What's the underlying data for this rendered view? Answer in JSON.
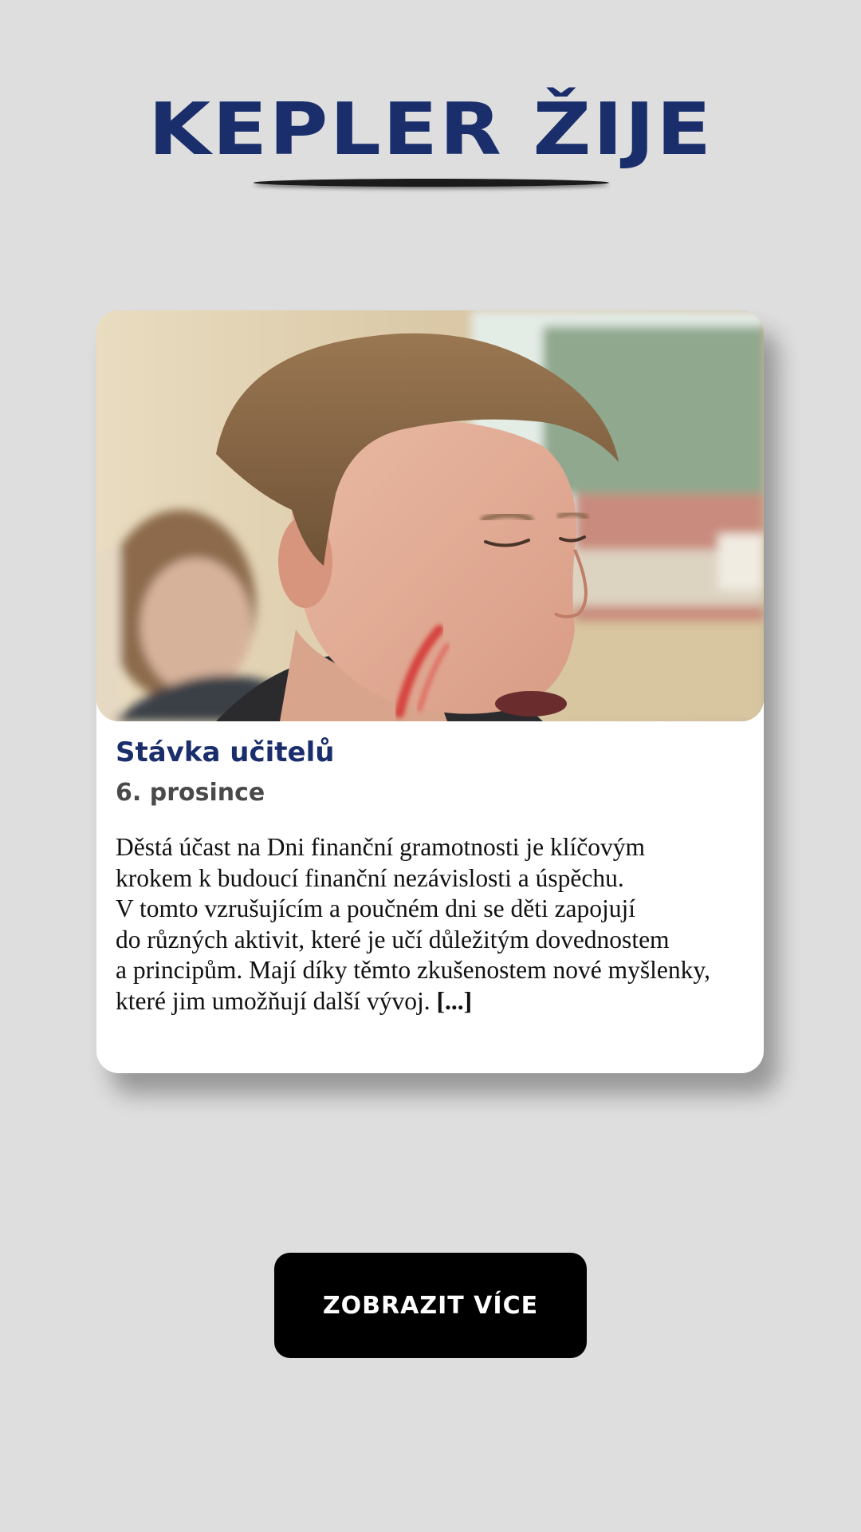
{
  "logo": {
    "text": "KEPLER ŽIJE"
  },
  "article": {
    "image_icon": "portrait-photo",
    "title": "Stávka učitelů",
    "date": "6. prosince",
    "body_lines": [
      "Děstá účast na Dni finanční gramotnosti je klíčovým",
      "krokem k budoucí finanční nezávislosti a úspěchu.",
      "V tomto vzrušujícím a poučném dni se děti zapojují",
      "do různých aktivit, které je učí důležitým dovednostem",
      "a principům. Mají díky těmto zkušenostem nové myšlenky,",
      "které jim umožňují další vývoj."
    ],
    "read_more": "[...]"
  },
  "buttons": {
    "show_more": "ZOBRAZIT VÍCE"
  },
  "colors": {
    "background": "#dedede",
    "brand_navy": "#1a2e6b",
    "card": "#ffffff",
    "button": "#000000",
    "button_text": "#ffffff"
  }
}
